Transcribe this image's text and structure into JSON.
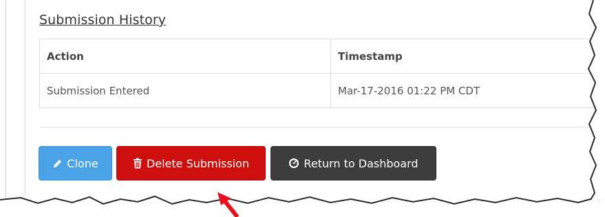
{
  "submission_history": {
    "title": "Submission History",
    "columns": [
      "Action",
      "Timestamp"
    ],
    "rows": [
      {
        "action": "Submission Entered",
        "timestamp": "Mar-17-2016 01:22 PM CDT"
      }
    ]
  },
  "buttons": {
    "clone": {
      "label": "Clone",
      "icon": "pencil-icon",
      "color": "#4aa3e6"
    },
    "delete": {
      "label": "Delete Submission",
      "icon": "trash-icon",
      "color": "#cf0e0e"
    },
    "return": {
      "label": "Return to Dashboard",
      "icon": "dashboard-icon",
      "color": "#3d3d3d"
    }
  },
  "annotation": {
    "arrow_color": "#e8101a"
  }
}
